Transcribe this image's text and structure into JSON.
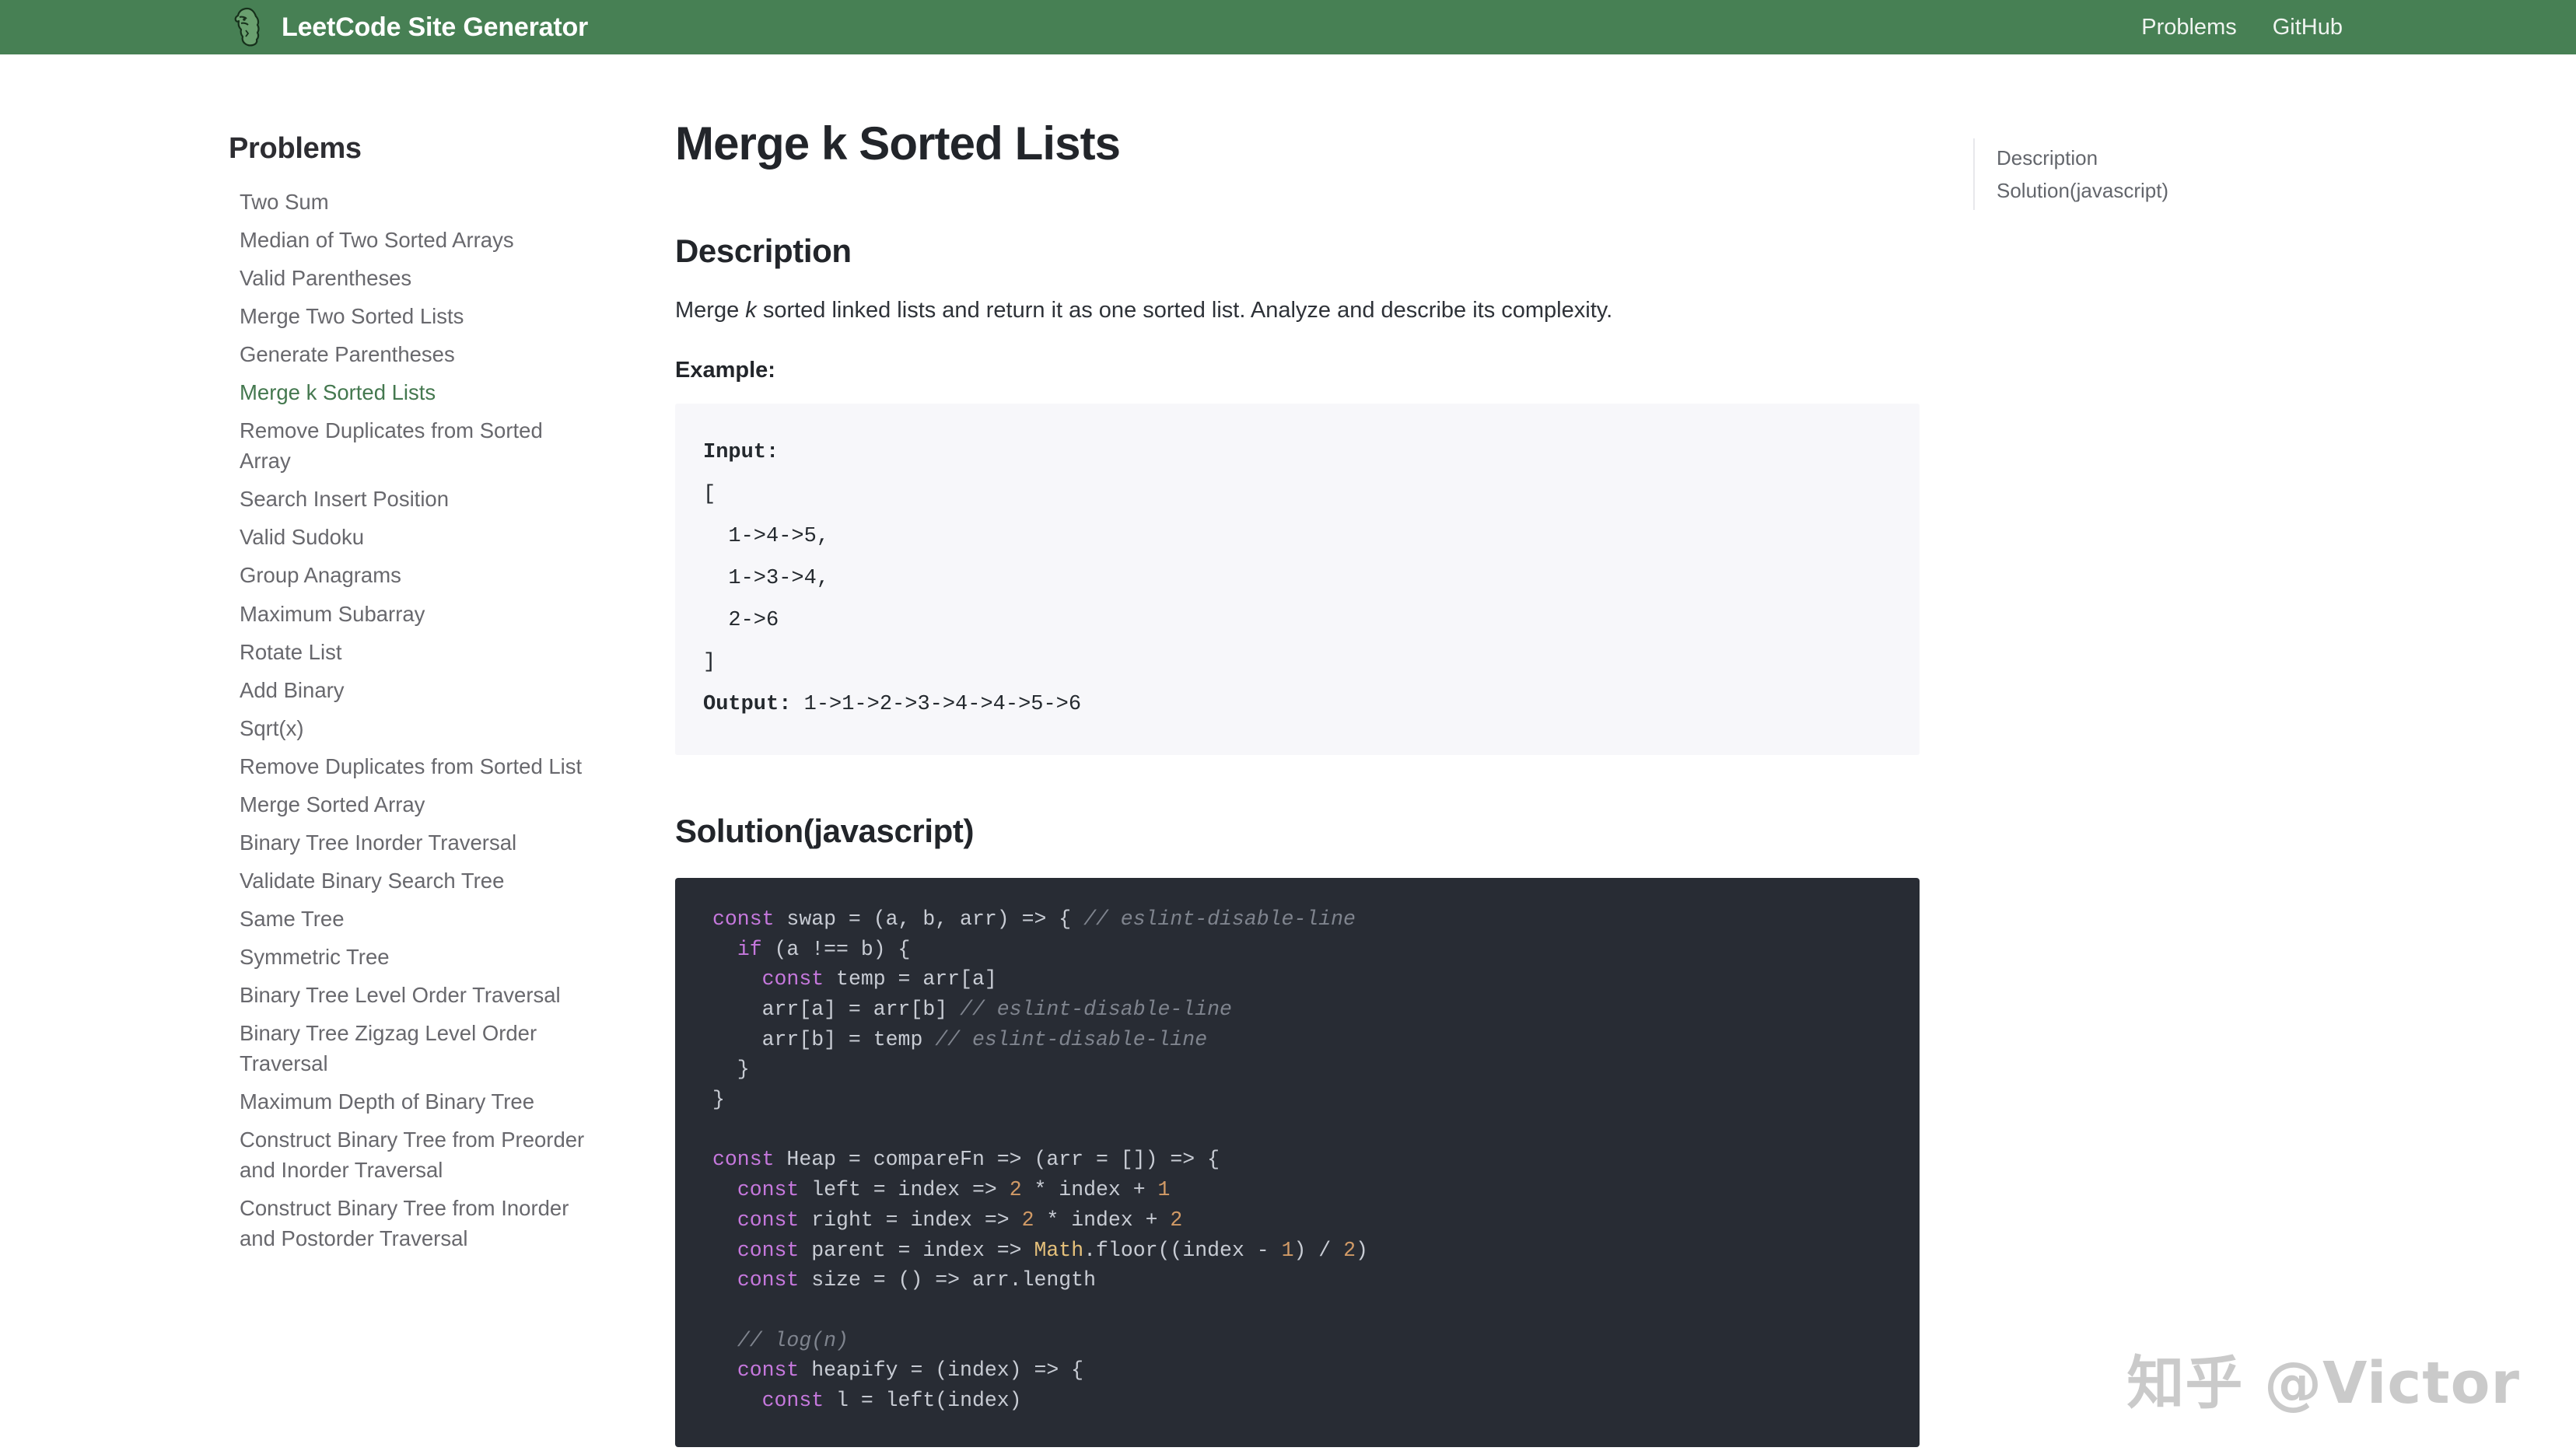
{
  "header": {
    "logo_icon": "gatsby-dino-logo-icon",
    "brand_title": "LeetCode Site Generator",
    "nav": [
      {
        "label": "Problems"
      },
      {
        "label": "GitHub"
      }
    ],
    "background_color": "#478054"
  },
  "sidebar": {
    "title": "Problems",
    "active_index": 5,
    "active_color": "#44784f",
    "items": [
      {
        "label": "Two Sum"
      },
      {
        "label": "Median of Two Sorted Arrays"
      },
      {
        "label": "Valid Parentheses"
      },
      {
        "label": "Merge Two Sorted Lists"
      },
      {
        "label": "Generate Parentheses"
      },
      {
        "label": "Merge k Sorted Lists"
      },
      {
        "label": "Remove Duplicates from Sorted Array"
      },
      {
        "label": "Search Insert Position"
      },
      {
        "label": "Valid Sudoku"
      },
      {
        "label": "Group Anagrams"
      },
      {
        "label": "Maximum Subarray"
      },
      {
        "label": "Rotate List"
      },
      {
        "label": "Add Binary"
      },
      {
        "label": "Sqrt(x)"
      },
      {
        "label": "Remove Duplicates from Sorted List"
      },
      {
        "label": "Merge Sorted Array"
      },
      {
        "label": "Binary Tree Inorder Traversal"
      },
      {
        "label": "Validate Binary Search Tree"
      },
      {
        "label": "Same Tree"
      },
      {
        "label": "Symmetric Tree"
      },
      {
        "label": "Binary Tree Level Order Traversal"
      },
      {
        "label": "Binary Tree Zigzag Level Order Traversal"
      },
      {
        "label": "Maximum Depth of Binary Tree"
      },
      {
        "label": "Construct Binary Tree from Preorder and Inorder Traversal"
      },
      {
        "label": "Construct Binary Tree from Inorder and Postorder Traversal"
      }
    ]
  },
  "main": {
    "problem_title": "Merge k Sorted Lists",
    "description_heading": "Description",
    "description_prefix": "Merge ",
    "description_emphasis": "k",
    "description_suffix": " sorted linked lists and return it as one sorted list. Analyze and describe its complexity.",
    "example_label": "Example:",
    "example_block": {
      "input_label": "Input:",
      "input_body": "[\n  1->4->5,\n  1->3->4,\n  2->6\n]",
      "output_label": "Output:",
      "output_value": "1->1->2->3->4->4->5->6"
    },
    "solution_heading": "Solution(javascript)",
    "solution_language": "javascript",
    "solution_code_background": "#282c34",
    "solution_code_lines": [
      "const swap = (a, b, arr) => { // eslint-disable-line",
      "  if (a !== b) {",
      "    const temp = arr[a]",
      "    arr[a] = arr[b] // eslint-disable-line",
      "    arr[b] = temp // eslint-disable-line",
      "  }",
      "}",
      "",
      "const Heap = compareFn => (arr = []) => {",
      "  const left = index => 2 * index + 1",
      "  const right = index => 2 * index + 2",
      "  const parent = index => Math.floor((index - 1) / 2)",
      "  const size = () => arr.length",
      "",
      "  // log(n)",
      "  const heapify = (index) => {",
      "    const l = left(index)"
    ]
  },
  "toc": {
    "items": [
      {
        "label": "Description"
      },
      {
        "label": "Solution(javascript)"
      }
    ]
  },
  "watermark": {
    "text": "知乎 @Victor"
  }
}
